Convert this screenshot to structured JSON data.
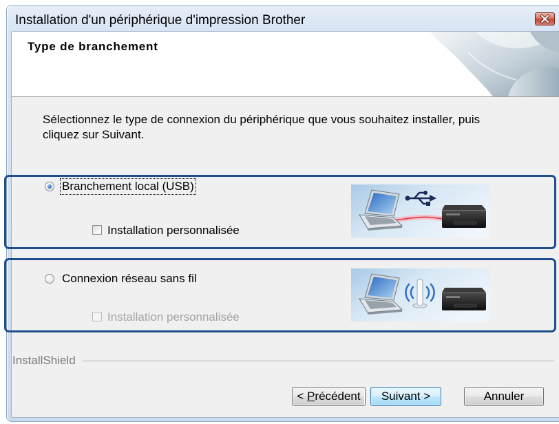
{
  "window": {
    "title": "Installation d'un périphérique d'impression Brother"
  },
  "header": {
    "title": "Type de branchement"
  },
  "instructions": {
    "line1": "Sélectionnez le type de connexion du périphérique que vous souhaitez installer, puis",
    "line2": "cliquez sur Suivant."
  },
  "options": [
    {
      "label": "Branchement local (USB)",
      "selected": true,
      "focused": true,
      "custom_install": {
        "label": "Installation personnalisée",
        "checked": false,
        "disabled": false
      }
    },
    {
      "label": "Connexion réseau sans fil",
      "selected": false,
      "focused": false,
      "custom_install": {
        "label": "Installation personnalisée",
        "checked": false,
        "disabled": true
      }
    }
  ],
  "footer": {
    "brand": "InstallShield",
    "buttons": {
      "previous": {
        "prefix": "< ",
        "accesskey": "P",
        "rest": "récédent"
      },
      "next": "Suivant >",
      "cancel": "Annuler"
    }
  },
  "icons": {
    "close": "close-icon",
    "header": "header-decoration-image",
    "usb_illustration": "usb-connection-illustration",
    "wireless_illustration": "wireless-connection-illustration"
  },
  "colors": {
    "highlight_border": "#1f4e8c",
    "default_button_border": "#3c7fb1",
    "close_button": "#c7432f"
  }
}
